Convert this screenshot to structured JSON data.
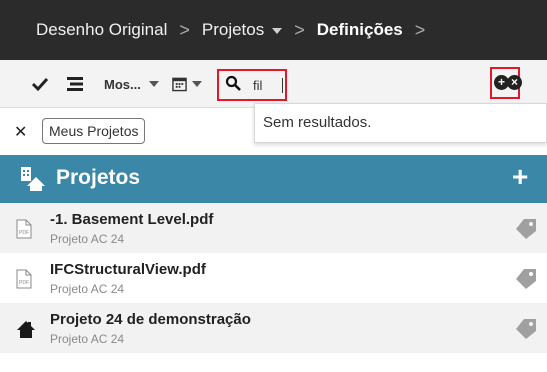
{
  "breadcrumb": {
    "items": [
      {
        "label": "Desenho Original"
      },
      {
        "label": "Projetos"
      },
      {
        "label": "Definições"
      }
    ],
    "separator": ">"
  },
  "toolbar": {
    "view_label": "Mos...",
    "search_value": "fil",
    "icons": [
      "check-icon",
      "menu-lines-icon",
      "calendar-icon",
      "search-icon",
      "add-circle-icon",
      "close-circle-icon"
    ]
  },
  "filter": {
    "chip_label": "Meus Projetos",
    "remove_icon": "close-icon"
  },
  "dropdown": {
    "message": "Sem resultados."
  },
  "section": {
    "title": "Projetos",
    "add_label": "+",
    "color": "#3b87a7"
  },
  "projects": [
    {
      "name": "-1. Basement Level.pdf",
      "subtitle": "Projeto AC 24",
      "icon": "pdf-file-icon"
    },
    {
      "name": "IFCStructuralView.pdf",
      "subtitle": "Projeto AC 24",
      "icon": "pdf-file-icon"
    },
    {
      "name": "Projeto 24 de demonstração",
      "subtitle": "Projeto AC 24",
      "icon": "house-icon"
    }
  ],
  "colors": {
    "topbar": "#2b2b2b",
    "highlight": "#e3162a",
    "accent": "#3b87a7"
  }
}
